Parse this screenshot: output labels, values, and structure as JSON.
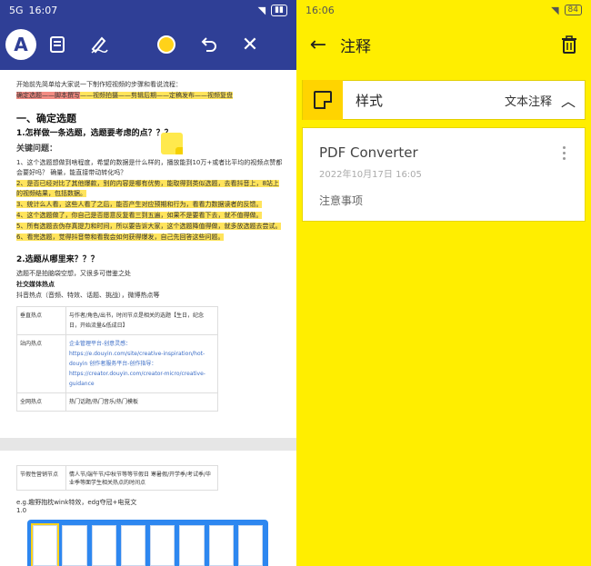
{
  "left": {
    "status": {
      "signal": "5G",
      "time": "16:07",
      "battery": ""
    },
    "toolbar": {
      "text_tool": "A",
      "close": "✕"
    },
    "doc": {
      "intro": "开始前先简单给大家说一下制作短视频的步骤和看说流程：",
      "flow_red": "确定选题——脚本撰写",
      "flow_rest": "——视频拍摄——剪辑后期——定稿发布——视频复盘",
      "h_section": "一、确定选题",
      "h_q1": "1.怎样做一条选题，选题要考虑的点？？？",
      "h_key": "关键问题：",
      "items": [
        "1、这个选题想做到啥程度，希望的数据是什么样的，播放能到10万+或者比平均的视频点赞都会要好吗？ 确量，能直接带动转化吗？",
        "2、是否已经对比了其他爆款，别的内容是哪有优势，能取得到类似选题，去看抖音上，8站上的视频结果，包括数据。",
        "3、统计么人看，这些人看了之后，能否产生对应预期和行为，看看力数据读者的反馈。",
        "4、这个选题做了，你自己是否愿意反复看三到五遍，如果不是要看下去，就不值得做。",
        "5、所有选题去伪存真提力和时间，所以要告诉大家，这个选题降值得做，就多放选题去尝试。",
        "6、看完选题，觉得抖音带和看我会如何获得爆发，自己先回答这些问题。"
      ],
      "h_q2": "2.选题从哪里来？？？",
      "q2_sub": "选题不是拍脑袋空想，又很多可借鉴之处",
      "h_social": "社交媒体热点",
      "social_line": "抖音热点（音频、特效、话题、挑战），微博热点等",
      "table": [
        {
          "k": "垂直热点",
          "v": "与作者/角色/出书，时间节点是相关的选题【生日，纪念日，开始流量&低成日】"
        },
        {
          "k": "站内热点",
          "v": "企业管理平台-创意灵感：https://e.douyin.com/site/creative-inspiration/hot-douyin  创作者服务平台-创作指导：https://creator.douyin.com/creator-micro/creative-guidance"
        },
        {
          "k": "全网热点",
          "v": "热门话题/热门音乐/热门模板"
        }
      ],
      "page2_table": {
        "k": "节假性营销节点",
        "v": "情人节/端午节/中秋节等等节假日  寒暑假/开学季/考试季/毕业季等面学生相关热点的时间点"
      },
      "page2_line": "e.g.趣野抱枕wink特效，edg夺冠+电竞文",
      "page2_frag": "1.0"
    }
  },
  "right": {
    "status": {
      "time": "16:06",
      "battery": "84"
    },
    "header": {
      "title": "注释"
    },
    "style": {
      "label": "样式",
      "value": "文本注释"
    },
    "note": {
      "title": "PDF Converter",
      "date": "2022年10月17日 16:05",
      "body": "注意事项"
    },
    "colors": {
      "background": "#ffee00",
      "accent": "#ffd400"
    }
  }
}
